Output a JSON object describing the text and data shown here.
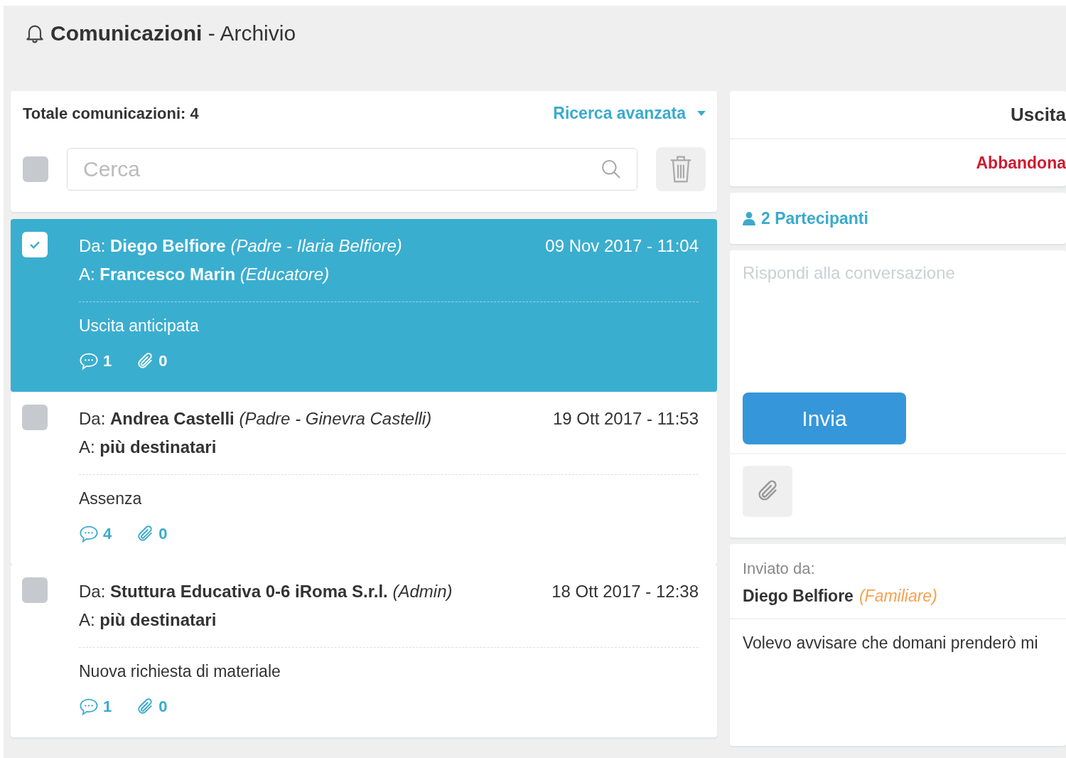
{
  "header": {
    "title": "Comunicazioni",
    "separator": "-",
    "subtitle": "Archivio"
  },
  "list": {
    "total": "Totale comunicazioni: 4",
    "advanced_search": "Ricerca avanzata",
    "select_all": {
      "checked": false
    },
    "search": {
      "placeholder": "Cerca"
    }
  },
  "messages": [
    {
      "selected": true,
      "checked": true,
      "from": "Da: **Diego Belfiore** *(Padre - Ilaria Belfiore)*",
      "to": "A: **Francesco Marin** *(Educatore)*",
      "date": "09 Nov 2017 - 11:04",
      "subject": "Uscita anticipata",
      "comments": "1",
      "attachments": "0"
    },
    {
      "selected": false,
      "checked": false,
      "from": "Da: **Andrea Castelli** *(Padre - Ginevra Castelli)*",
      "to": "A: **più destinatari**",
      "date": "19 Ott 2017 - 11:53",
      "subject": "Assenza",
      "comments": "4",
      "attachments": "0"
    },
    {
      "selected": false,
      "checked": false,
      "from": "Da: **Stuttura Educativa 0-6 iRoma S.r.l.** *(Admin)*",
      "to": "A: **più destinatari**",
      "date": "18 Ott 2017 - 12:38",
      "subject": "Nuova richiesta di materiale",
      "comments": "1",
      "attachments": "0"
    }
  ],
  "detail": {
    "title": "Uscita",
    "leave": "Abbandona",
    "participants": "2 Partecipanti",
    "reply": {
      "placeholder": "Rispondi alla conversazione"
    },
    "send": "Invia",
    "sent_by_label": "Inviato da:",
    "sender": "Diego Belfiore",
    "sender_role": "(Familiare)",
    "body": "Volevo avvisare che domani prenderò mi"
  }
}
